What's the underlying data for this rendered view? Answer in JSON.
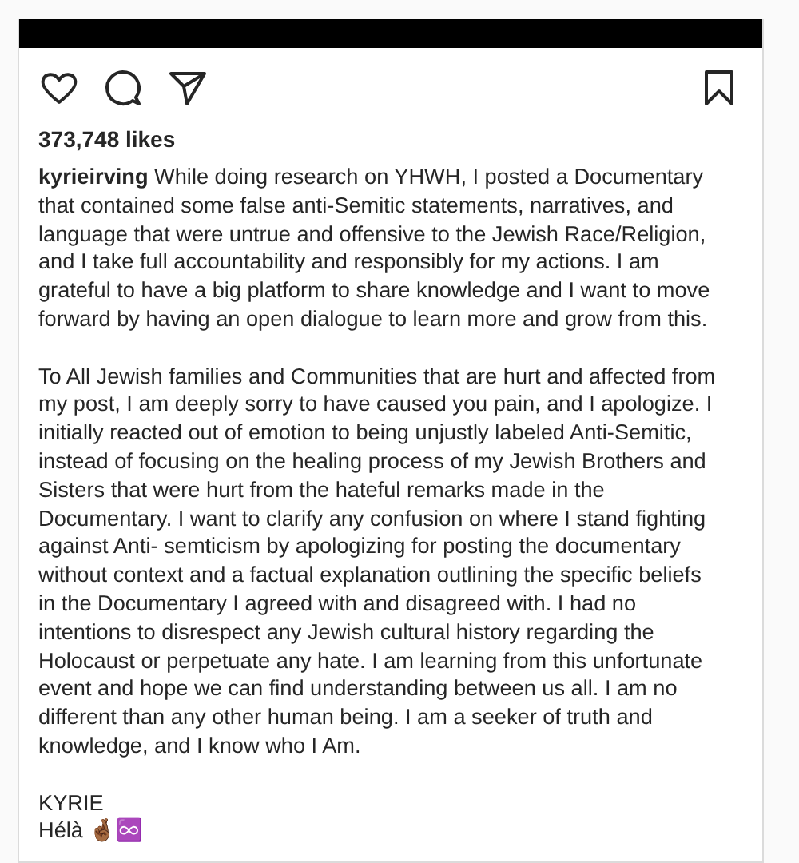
{
  "post": {
    "likes": "373,748 likes",
    "caption": [
      "**kyrieirving** While doing research on YHWH, I posted a Documentary that contained some false anti-Semitic statements, narratives, and language that were untrue and offensive to the Jewish Race/Religion, and I take full accountability and responsibly for my actions. I am grateful to have a big platform to share knowledge and I want to move forward by having an open dialogue to learn more and grow from this.",
      "To All Jewish families and Communities that are hurt and affected from my post, I am deeply sorry to have caused you pain, and I apologize. I initially reacted out of emotion to being unjustly labeled Anti-Semitic, instead of focusing on the healing process of my Jewish Brothers and Sisters that were hurt from the hateful remarks made in the Documentary. I want to clarify any confusion on where I stand fighting against Anti- semticism by apologizing for posting the documentary without context and a factual explanation outlining the specific beliefs in the Documentary I agreed with and disagreed with. I had no intentions to disrespect any Jewish cultural history regarding the Holocaust or perpetuate any hate. I am learning from this unfortunate event and hope we can find understanding between us all. I am no different than any other human being. I am a seeker of truth and knowledge, and I know who I Am."
    ],
    "signature": [
      "KYRIE",
      "Hélà 🤞🏾♾️"
    ],
    "liked": false,
    "saved": false
  }
}
